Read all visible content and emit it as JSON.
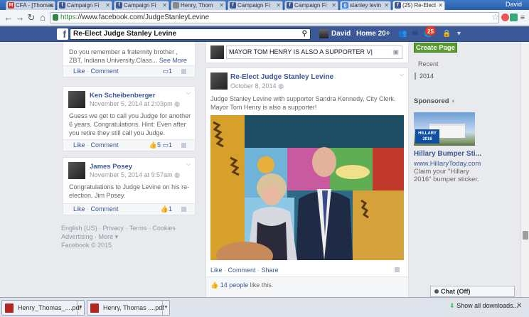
{
  "browser": {
    "tabs": [
      {
        "label": "CFA - [Thomas",
        "favicon": "M",
        "favicon_color": "#d93025"
      },
      {
        "label": "Campaign Fi",
        "favicon": "f",
        "favicon_color": "#3b5998"
      },
      {
        "label": "Campaign Fi",
        "favicon": "f",
        "favicon_color": "#3b5998"
      },
      {
        "label": "Henry, Thom",
        "favicon": "",
        "favicon_color": "#888888"
      },
      {
        "label": "Campaign Fi",
        "favicon": "f",
        "favicon_color": "#3b5998"
      },
      {
        "label": "Campaign Fi",
        "favicon": "f",
        "favicon_color": "#3b5998"
      },
      {
        "label": "stanley levin",
        "favicon": "g",
        "favicon_color": "#4285f4"
      },
      {
        "label": "(25) Re-Elect",
        "favicon": "f",
        "favicon_color": "#3b5998"
      }
    ],
    "active_tab_index": 7,
    "profile_name": "David",
    "url_scheme": "https",
    "url_rest": "://www.facebook.com/JudgeStanleyLevine"
  },
  "fb_header": {
    "logo": "f",
    "search_value": "Re-Elect Judge Stanley Levine",
    "user_name": "David",
    "home_label": "Home",
    "home_count": "20+",
    "notification_count": "25"
  },
  "left_column": {
    "comment_partial": {
      "text": "Do you remember a fraternity brother , ZBT, Indiana University.Class...",
      "see_more": "See More",
      "like": "Like",
      "comment": "Comment",
      "comment_count": "1"
    },
    "comments": [
      {
        "name": "Ken Scheibenberger",
        "date": "November 5, 2014 at 2:03pm",
        "text": "Guess we get to call you Judge for another 6 years. Congratulations. Hint: Even after you retire they still call you Judge.",
        "like": "Like",
        "comment": "Comment",
        "like_count": "5",
        "comment_count": "1"
      },
      {
        "name": "James Posey",
        "date": "November 5, 2014 at 9:57am",
        "text": "Congratulations to Judge Levine on his re-election. Jim Posey.",
        "like": "Like",
        "comment": "Comment",
        "like_count": "1"
      }
    ],
    "footer_links": [
      "English (US)",
      "Privacy",
      "Terms",
      "Cookies",
      "Advertising",
      "More"
    ],
    "copyright": "Facebook © 2015"
  },
  "composer": {
    "value": "MAYOR TOM HENRY IS ALSO A SUPPORTER  V|"
  },
  "post": {
    "author": "Re-Elect Judge Stanley Levine",
    "date": "October 8, 2014",
    "text": "Judge Stanley Levine with supporter Sandra Kennedy, City Clerk. Mayor Tom Henry is also a supporter!",
    "actions": [
      "Like",
      "Comment",
      "Share"
    ],
    "likes_count": "14 people",
    "likes_suffix": " like this."
  },
  "right_column": {
    "create_page": "Create Page",
    "timeline_years": [
      "Recent",
      "2014"
    ],
    "sponsored": "Sponsored",
    "ad": {
      "logo_text": "HILLARY 2016",
      "title": "Hillary Bumper Sti...",
      "url": "www.HillaryToday.com",
      "description": "Claim your \"Hillary 2016\" bumper sticker."
    },
    "chat_label": "Chat (Off)"
  },
  "download_shelf": {
    "items": [
      "Henry_Thomas_....pdf",
      "Henry, Thomas ....pdf"
    ],
    "show_all": "Show all downloads..."
  }
}
